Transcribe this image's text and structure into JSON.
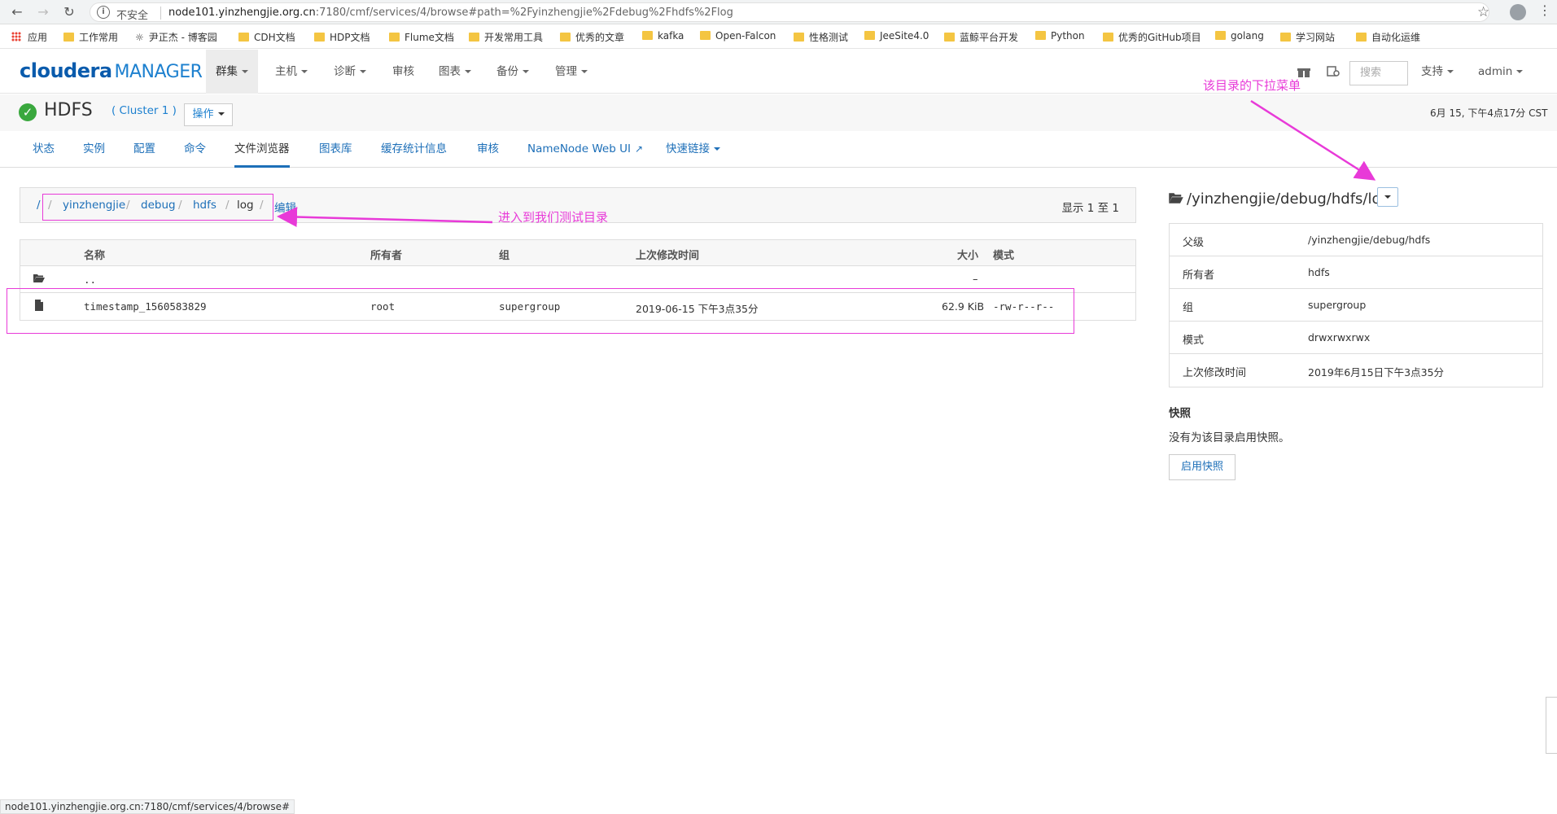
{
  "browser": {
    "insecure_label": "不安全",
    "url_host": "node101.yinzhengjie.org.cn",
    "url_rest": ":7180/cmf/services/4/browse#path=%2Fyinzhengjie%2Fdebug%2Fhdfs%2Flog",
    "bookmarks": [
      "应用",
      "工作常用",
      "尹正杰 - 博客园",
      "CDH文档",
      "HDP文档",
      "Flume文档",
      "开发常用工具",
      "优秀的文章",
      "kafka",
      "Open-Falcon",
      "性格测试",
      "JeeSite4.0",
      "蓝鲸平台开发",
      "Python",
      "优秀的GitHub项目",
      "golang",
      "学习网站",
      "自动化运维"
    ]
  },
  "cm_nav": {
    "logo_main": "cloudera",
    "logo_sub": "MANAGER",
    "items": [
      "群集",
      "主机",
      "诊断",
      "审核",
      "图表",
      "备份",
      "管理"
    ],
    "search_placeholder": "搜索",
    "support": "支持",
    "user": "admin"
  },
  "service": {
    "name": "HDFS",
    "cluster": "( Cluster 1 )",
    "actions": "操作",
    "time": "6月 15, 下午4点17分 CST"
  },
  "tabs": [
    "状态",
    "实例",
    "配置",
    "命令",
    "文件浏览器",
    "图表库",
    "缓存统计信息",
    "审核",
    "NameNode Web UI",
    "快速链接"
  ],
  "breadcrumb": {
    "root": "/",
    "items": [
      "yinzhengjie",
      "debug",
      "hdfs",
      "log"
    ],
    "edit": "编辑",
    "count": "显示 1 至 1"
  },
  "file_table": {
    "headers": [
      "名称",
      "所有者",
      "组",
      "上次修改时间",
      "大小",
      "模式"
    ],
    "parent_row": {
      "name": "..",
      "size": "–"
    },
    "rows": [
      {
        "name": "timestamp_1560583829",
        "owner": "root",
        "group": "supergroup",
        "modified": "2019-06-15 下午3点35分",
        "size": "62.9 KiB",
        "mode": "-rw-r--r--"
      }
    ]
  },
  "side_panel": {
    "path": "/yinzhengjie/debug/hdfs/log",
    "info": [
      {
        "key": "父级",
        "value": "/yinzhengjie/debug/hdfs"
      },
      {
        "key": "所有者",
        "value": "hdfs"
      },
      {
        "key": "组",
        "value": "supergroup"
      },
      {
        "key": "模式",
        "value": "drwxrwxrwx"
      },
      {
        "key": "上次修改时间",
        "value": "2019年6月15日下午3点35分"
      }
    ],
    "snapshot_title": "快照",
    "snapshot_text": "没有为该目录启用快照。",
    "snapshot_button": "启用快照"
  },
  "annotations": {
    "dropdown_note": "该目录的下拉菜单",
    "dir_note": "进入到我们测试目录"
  },
  "status_bar": "node101.yinzhengjie.org.cn:7180/cmf/services/4/browse#",
  "colors": {
    "accent": "#1d6fb8",
    "annotation": "#e83ad8",
    "ok": "#3aa83e"
  }
}
